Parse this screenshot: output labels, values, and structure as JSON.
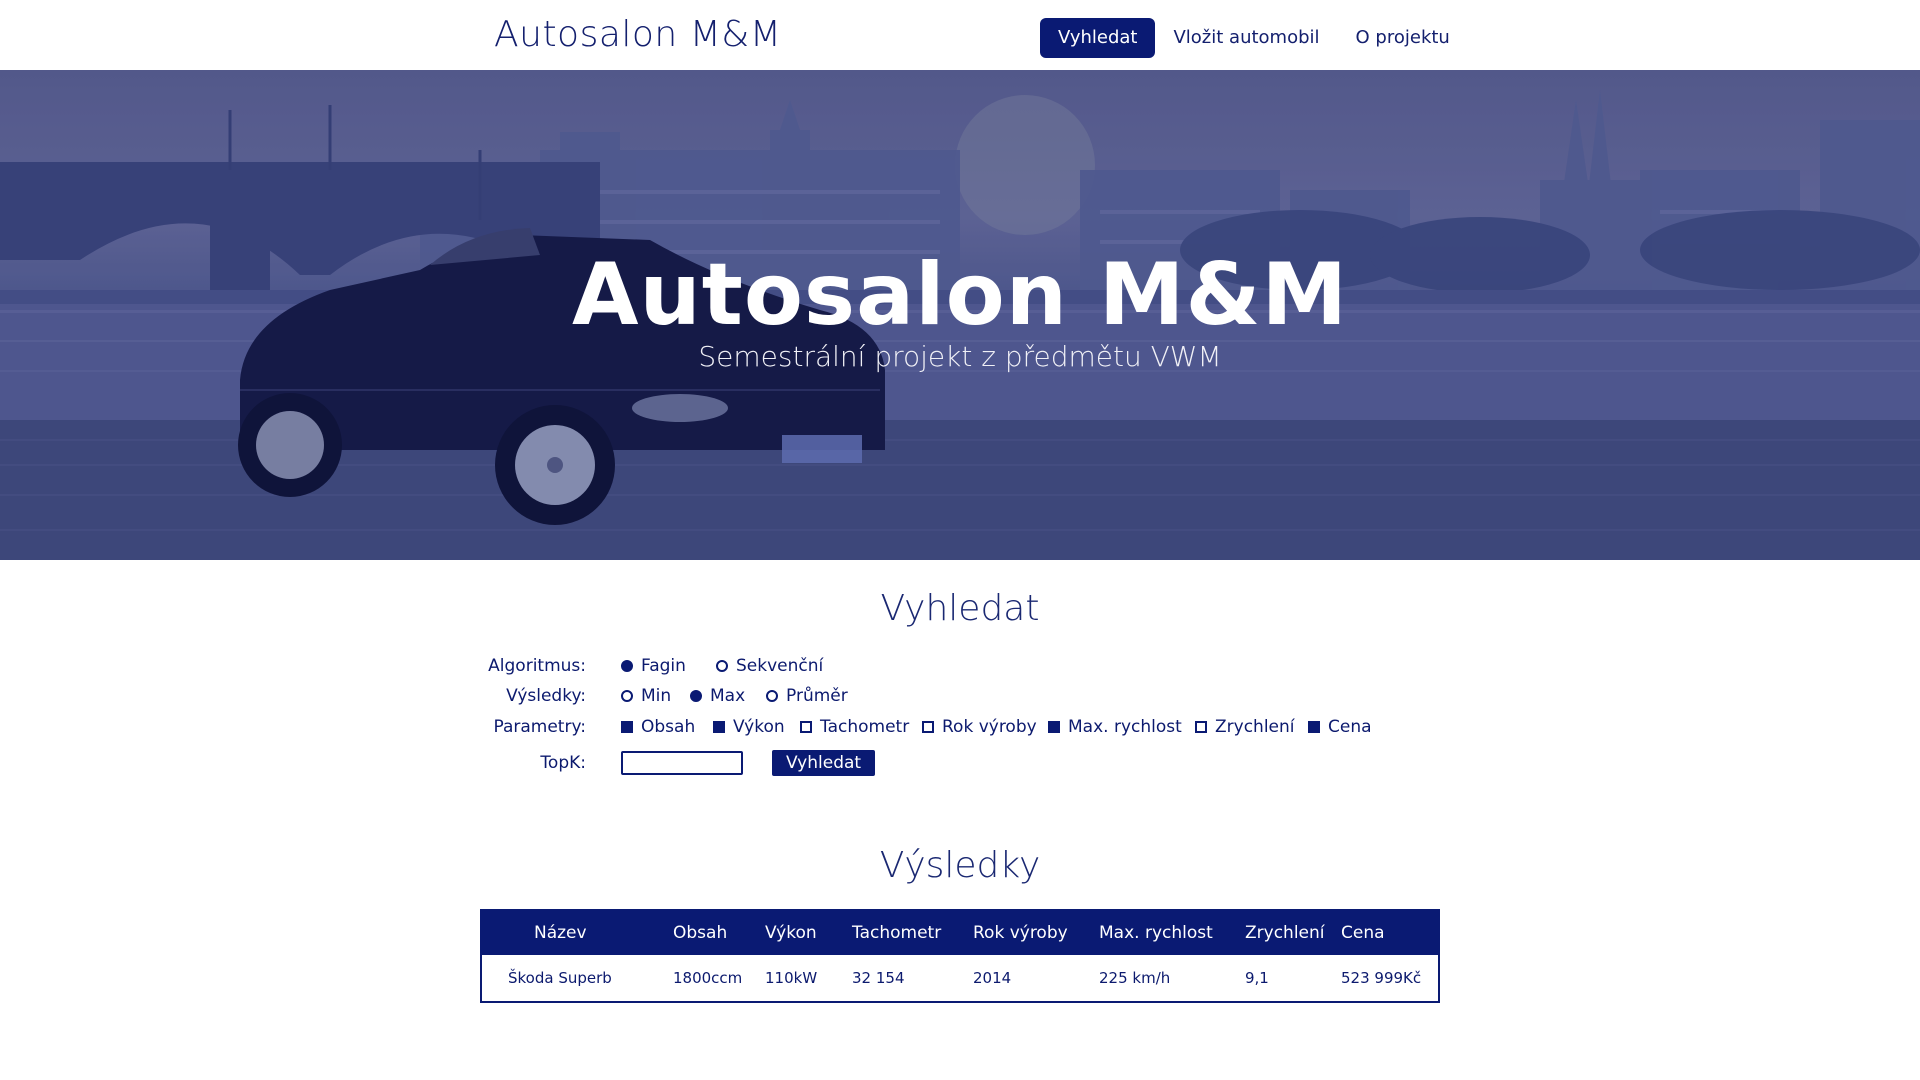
{
  "header": {
    "brand": "Autosalon M&M",
    "nav": [
      {
        "label": "Vyhledat",
        "active": true
      },
      {
        "label": "Vložit automobil",
        "active": false
      },
      {
        "label": "O projektu",
        "active": false
      }
    ]
  },
  "hero": {
    "title": "Autosalon M&M",
    "subtitle": "Semestrální projekt z předmětu VWM"
  },
  "search": {
    "title": "Vyhledat",
    "algorithm_label": "Algoritmus:",
    "algorithm_options": [
      {
        "label": "Fagin",
        "selected": true
      },
      {
        "label": "Sekvenční",
        "selected": false
      }
    ],
    "results_label": "Výsledky:",
    "results_options": [
      {
        "label": "Min",
        "selected": false
      },
      {
        "label": "Max",
        "selected": true
      },
      {
        "label": "Průměr",
        "selected": false
      }
    ],
    "params_label": "Parametry:",
    "params_options": [
      {
        "label": "Obsah",
        "checked": true
      },
      {
        "label": "Výkon",
        "checked": true
      },
      {
        "label": "Tachometr",
        "checked": false
      },
      {
        "label": "Rok výroby",
        "checked": false
      },
      {
        "label": "Max. rychlost",
        "checked": true
      },
      {
        "label": "Zrychlení",
        "checked": false
      },
      {
        "label": "Cena",
        "checked": true
      }
    ],
    "topk_label": "TopK:",
    "topk_value": "",
    "button_label": "Vyhledat"
  },
  "results": {
    "title": "Výsledky",
    "columns": [
      "Název",
      "Obsah",
      "Výkon",
      "Tachometr",
      "Rok výroby",
      "Max. rychlost",
      "Zrychlení",
      "Cena"
    ],
    "rows": [
      [
        "Škoda Superb",
        "1800ccm",
        "110kW",
        "32 154",
        "2014",
        "225 km/h",
        "9,1",
        "523 999Kč"
      ]
    ]
  },
  "colors": {
    "primary": "#0a1a73",
    "text": "#14206e",
    "hero_overlay": "#4a5487"
  }
}
